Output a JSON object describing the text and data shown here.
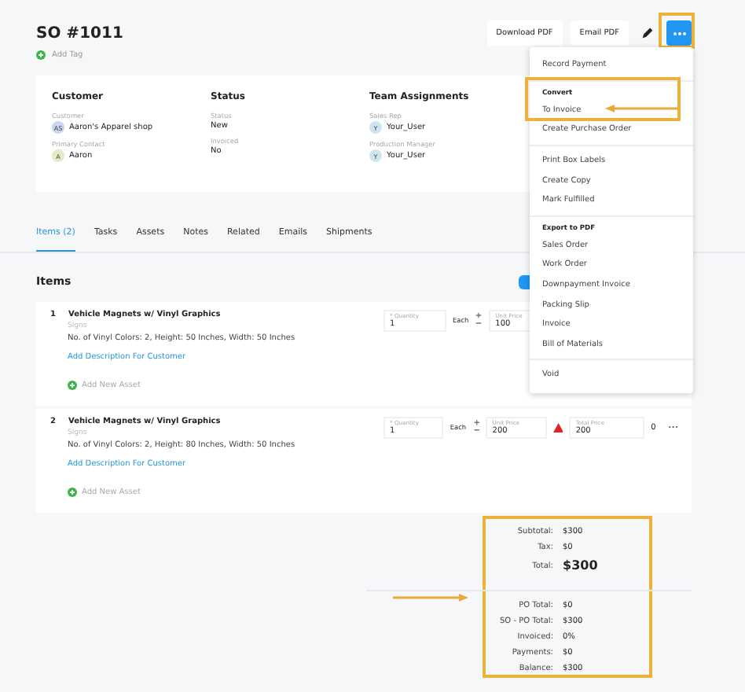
{
  "header": {
    "title": "SO #1011",
    "add_tag": "Add Tag",
    "buttons": [
      "Download PDF",
      "Email PDF"
    ]
  },
  "summary": {
    "columns": [
      {
        "heading": "Customer",
        "fields": [
          {
            "label": "Customer",
            "value": "Aaron's Apparel shop",
            "avatar": "AS",
            "color": "#c9d6ec"
          },
          {
            "label": "Primary Contact",
            "value": "Aaron",
            "avatar": "A",
            "color": "#e3ecc4"
          }
        ]
      },
      {
        "heading": "Status",
        "fields": [
          {
            "label": "Status",
            "value": "New"
          },
          {
            "label": "Invoiced",
            "value": "No"
          }
        ]
      },
      {
        "heading": "Team Assignments",
        "fields": [
          {
            "label": "Sales Rep",
            "value": "Your_User",
            "avatar": "Y",
            "color": "#cfe6f0"
          },
          {
            "label": "Production Manager",
            "value": "Your_User",
            "avatar": "Y",
            "color": "#cfe6f0"
          }
        ]
      }
    ]
  },
  "tabs": [
    {
      "label": "Items (2)",
      "selected": true
    },
    {
      "label": "Tasks",
      "selected": false
    },
    {
      "label": "Assets",
      "selected": false
    },
    {
      "label": "Notes",
      "selected": false
    },
    {
      "label": "Related",
      "selected": false
    },
    {
      "label": "Emails",
      "selected": false
    },
    {
      "label": "Shipments",
      "selected": false
    }
  ],
  "items": {
    "title": "Items",
    "rows": [
      {
        "number": "1",
        "name": "Vehicle Magnets w/ Vinyl Graphics",
        "category": "Signs",
        "description": "No. of Vinyl Colors: 2, Height: 50 Inches, Width: 50 Inches",
        "link": "Add Description For Customer",
        "add_asset": "Add New Asset",
        "quantity_label": "* Quantity",
        "quantity": "1",
        "unit": "Each",
        "unit_price_label": "Unit Price",
        "unit_price": "100"
      },
      {
        "number": "2",
        "name": "Vehicle Magnets w/ Vinyl Graphics",
        "category": "Signs",
        "description": "No. of Vinyl Colors: 2, Height: 80 Inches, Width: 50 Inches",
        "link": "Add Description For Customer",
        "add_asset": "Add New Asset",
        "quantity_label": "* Quantity",
        "quantity": "1",
        "unit": "Each",
        "unit_price_label": "Unit Price",
        "unit_price": "200",
        "warning": true,
        "total_price_label": "Total Price",
        "total_price": "200",
        "count": "0"
      }
    ]
  },
  "totals": [
    [
      {
        "label": "Subtotal:",
        "value": "$300",
        "kind": "line"
      },
      {
        "label": "Tax:",
        "value": "$0",
        "kind": "line"
      },
      {
        "label": "Total:",
        "value": "$300",
        "kind": "grand"
      }
    ],
    [
      {
        "label": "PO Total:",
        "value": "$0",
        "kind": "line"
      },
      {
        "label": "SO - PO Total:",
        "value": "$300",
        "kind": "line"
      },
      {
        "label": "Invoiced:",
        "value": "0%",
        "kind": "line"
      },
      {
        "label": "Payments:",
        "value": "$0",
        "kind": "line"
      },
      {
        "label": "Balance:",
        "value": "$300",
        "kind": "line"
      }
    ]
  ],
  "menu": {
    "sections": [
      {
        "items": [
          "Record Payment"
        ]
      },
      {
        "header": "Convert",
        "items": [
          "To Invoice",
          "Create Purchase Order"
        ]
      },
      {
        "items": [
          "Print Box Labels",
          "Create Copy",
          "Mark Fulfilled"
        ]
      },
      {
        "header": "Export to PDF",
        "items": [
          "Sales Order",
          "Work Order",
          "Downpayment Invoice",
          "Packing Slip",
          "Invoice",
          "Bill of Materials"
        ]
      },
      {
        "items": [
          "Void"
        ]
      }
    ]
  }
}
